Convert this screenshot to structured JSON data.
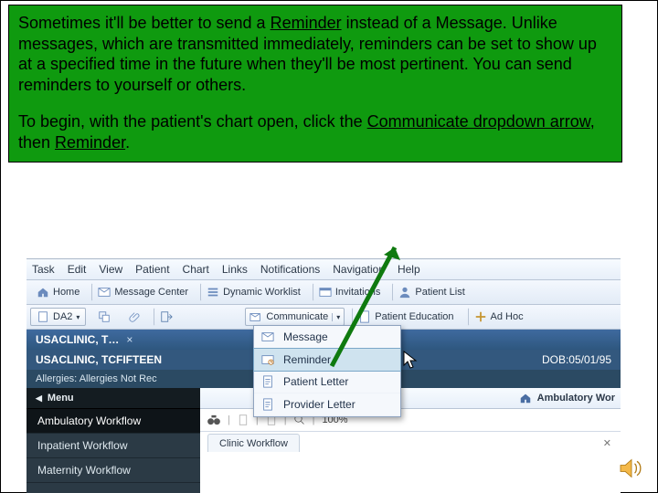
{
  "callout": {
    "p1_a": "Sometimes it'll be better to send a ",
    "p1_b": "Reminder",
    "p1_c": " instead of a Message.  Unlike messages, which are transmitted immediately, reminders can be set to show up at a specified time in the future when they'll be most pertinent.  You can send reminders to yourself or others.",
    "p2_a": "To begin, with the patient's chart open, click the ",
    "p2_b": "Communicate dropdown arrow",
    "p2_c": ", then ",
    "p2_d": "Reminder",
    "p2_e": "."
  },
  "menu": {
    "task": "Task",
    "edit": "Edit",
    "view": "View",
    "patient": "Patient",
    "chart": "Chart",
    "links": "Links",
    "notifications": "Notifications",
    "navigation": "Navigation",
    "help": "Help"
  },
  "toolbar1": {
    "home": "Home",
    "msgctr": "Message Center",
    "dynlist": "Dynamic Worklist",
    "invites": "Invitations",
    "ptlist": "Patient List"
  },
  "toolbar2": {
    "da2": "DA2",
    "communicate": "Communicate",
    "pted": "Patient Education",
    "adhoc": "Ad Hoc"
  },
  "dropdown": {
    "message": "Message",
    "reminder": "Reminder",
    "letter": "Patient Letter",
    "provider": "Provider Letter"
  },
  "banner": {
    "tab": "USACLINIC, T…",
    "name": "USACLINIC, TCFIFTEEN",
    "dob_label": "DOB:",
    "dob": "05/01/95",
    "allergies": "Allergies: Allergies Not Rec"
  },
  "sidebar": {
    "menu": "Menu",
    "amb": "Ambulatory Workflow",
    "inpt": "Inpatient Workflow",
    "mat": "Maternity Workflow"
  },
  "main": {
    "amb_title": "Ambulatory Wor",
    "zoom": "100%",
    "clinic": "Clinic Workflow"
  }
}
